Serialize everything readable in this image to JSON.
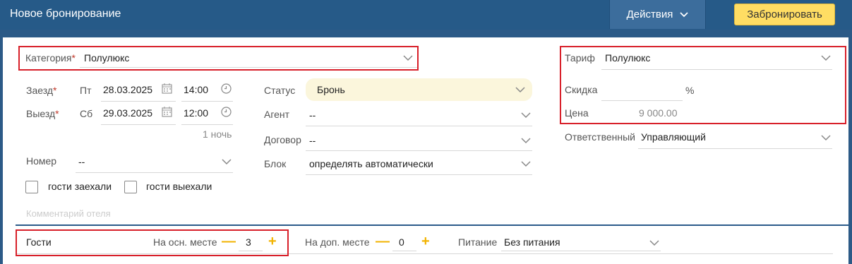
{
  "header": {
    "title": "Новое бронирование",
    "actions_label": "Действия",
    "book_label": "Забронировать"
  },
  "category": {
    "label": "Категория",
    "required": "*",
    "value": "Полулюкс"
  },
  "dates": {
    "checkin_label": "Заезд",
    "checkin_weekday": "Пт",
    "checkin_date": "28.03.2025",
    "checkin_time": "14:00",
    "checkout_label": "Выезд",
    "checkout_weekday": "Сб",
    "checkout_date": "29.03.2025",
    "checkout_time": "12:00",
    "nights": "1 ночь",
    "required": "*"
  },
  "room": {
    "label": "Номер",
    "value": "--"
  },
  "checks": {
    "arrived": "гости заехали",
    "departed": "гости выехали"
  },
  "comment_placeholder": "Комментарий отеля",
  "status": {
    "label": "Статус",
    "value": "Бронь"
  },
  "agent": {
    "label": "Агент",
    "value": "--"
  },
  "contract": {
    "label": "Договор",
    "value": "--"
  },
  "block": {
    "label": "Блок",
    "value": "определять автоматически"
  },
  "tariff": {
    "label": "Тариф",
    "value": "Полулюкс"
  },
  "discount": {
    "label": "Скидка",
    "unit": "%"
  },
  "price": {
    "label": "Цена",
    "value": "9 000.00"
  },
  "responsible": {
    "label": "Ответственный",
    "value": "Управляющий"
  },
  "guests": {
    "label": "Гости",
    "main_label": "На осн. месте",
    "main_value": "3",
    "extra_label": "На доп. месте",
    "extra_value": "0",
    "minus": "—",
    "plus": "+"
  },
  "meals": {
    "label": "Питание",
    "value": "Без питания"
  },
  "colors": {
    "header": "#265a88",
    "accent_button": "#ffdd63",
    "highlight_border": "#d8202a",
    "status_bg": "#fbf6dc",
    "stepper": "#f2b300"
  }
}
